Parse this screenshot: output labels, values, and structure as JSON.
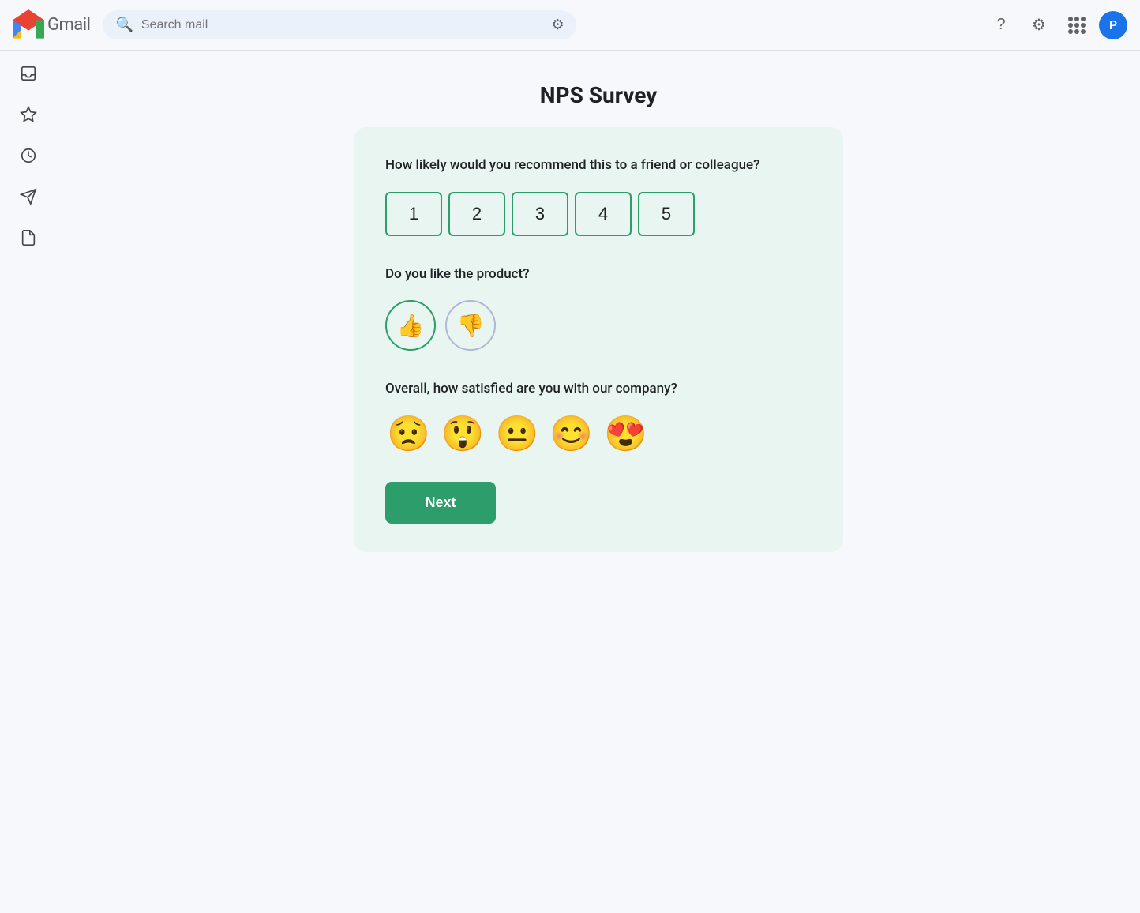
{
  "app": {
    "title": "Gmail",
    "logo_letter": "M"
  },
  "header": {
    "search_placeholder": "Search mail",
    "avatar_letter": "P",
    "help_icon": "?",
    "settings_icon": "⚙",
    "apps_icon": "⋮⋮⋮"
  },
  "sidebar": {
    "items": [
      {
        "icon": "inbox-icon",
        "symbol": "⬚"
      },
      {
        "icon": "star-icon",
        "symbol": "☆"
      },
      {
        "icon": "clock-icon",
        "symbol": "🕐"
      },
      {
        "icon": "send-icon",
        "symbol": "▷"
      },
      {
        "icon": "draft-icon",
        "symbol": "📄"
      }
    ]
  },
  "survey": {
    "title": "NPS Survey",
    "question1": "How likely would you recommend this to a friend or colleague?",
    "nps_values": [
      "1",
      "2",
      "3",
      "4",
      "5"
    ],
    "question2": "Do you like the product?",
    "thumbs": {
      "up": "👍",
      "down": "👎"
    },
    "question3": "Overall, how satisfied are you with our company?",
    "emojis": [
      "😟",
      "😲",
      "😐",
      "😊",
      "😍"
    ],
    "next_label": "Next"
  }
}
